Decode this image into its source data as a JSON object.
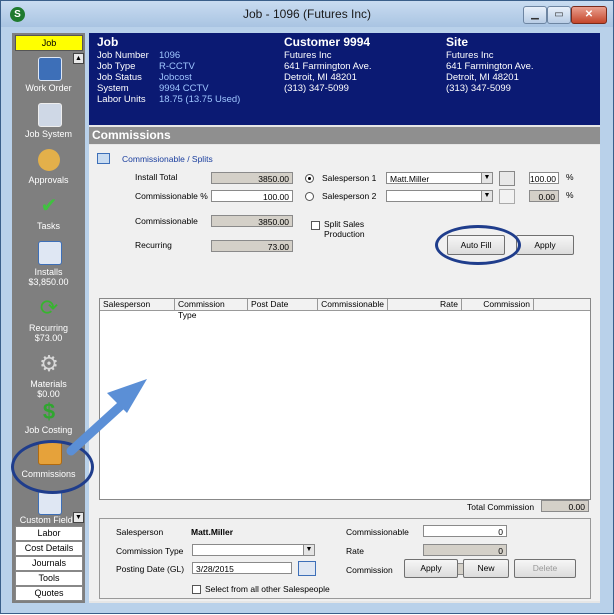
{
  "window": {
    "title": "Job - 1096 (Futures  Inc)",
    "app_icon": "S"
  },
  "sidebar": {
    "header": "Job",
    "items": [
      {
        "label": "Work Order",
        "sub": "",
        "icon": "work-order-icon"
      },
      {
        "label": "Job System",
        "sub": "",
        "icon": "job-system-icon"
      },
      {
        "label": "Approvals",
        "sub": "",
        "icon": "approvals-icon"
      },
      {
        "label": "Tasks",
        "sub": "",
        "icon": "tasks-icon"
      },
      {
        "label": "Installs",
        "sub": "$3,850.00",
        "icon": "installs-icon"
      },
      {
        "label": "Recurring",
        "sub": "$73.00",
        "icon": "recurring-icon"
      },
      {
        "label": "Materials",
        "sub": "$0.00",
        "icon": "materials-icon"
      },
      {
        "label": "Job Costing",
        "sub": "",
        "icon": "dollar-icon"
      },
      {
        "label": "Commissions",
        "sub": "",
        "icon": "commissions-icon"
      },
      {
        "label": "Custom Fields",
        "sub": "",
        "icon": "custom-fields-icon"
      }
    ],
    "links": [
      "Labor",
      "Cost Details",
      "Journals",
      "Tools",
      "Quotes"
    ]
  },
  "job": {
    "heading": "Job",
    "rows": [
      {
        "k": "Job Number",
        "v": "1096"
      },
      {
        "k": "Job Type",
        "v": "R-CCTV"
      },
      {
        "k": "Job Status",
        "v": "Jobcost"
      },
      {
        "k": "System",
        "v": "9994 CCTV"
      },
      {
        "k": "Labor Units",
        "v": "18.75 (13.75 Used)"
      }
    ]
  },
  "customer": {
    "heading": "Customer 9994",
    "lines": [
      "Futures  Inc",
      "641 Farmington Ave.",
      "Detroit, MI  48201",
      "(313) 347-5099"
    ]
  },
  "site": {
    "heading": "Site",
    "lines": [
      "Futures  Inc",
      "641 Farmington Ave.",
      "Detroit, MI  48201",
      "(313) 347-5099"
    ]
  },
  "commissions": {
    "title": "Commissions",
    "subtitle": "Commissionable / Splits",
    "install_total_label": "Install Total",
    "install_total": "3850.00",
    "commissionable_pct_label": "Commissionable %",
    "commissionable_pct": "100.00",
    "commissionable_label": "Commissionable",
    "commissionable": "3850.00",
    "recurring_label": "Recurring",
    "recurring": "73.00",
    "salesperson1_label": "Salesperson 1",
    "salesperson1": "Matt.Miller",
    "salesperson1_pct": "100.00",
    "salesperson2_label": "Salesperson 2",
    "salesperson2": "",
    "salesperson2_pct": "0.00",
    "pct_sign": "%",
    "split_label_1": "Split Sales",
    "split_label_2": "Production",
    "auto_fill": "Auto Fill",
    "apply": "Apply"
  },
  "grid": {
    "columns": [
      "Salesperson",
      "Commission Type",
      "Post Date",
      "Commissionable",
      "Rate",
      "Commission"
    ],
    "rows": []
  },
  "totals": {
    "label": "Total Commission",
    "value": "0.00"
  },
  "detail": {
    "salesperson_label": "Salesperson",
    "salesperson": "Matt.Miller",
    "commission_type_label": "Commission Type",
    "commission_type": "",
    "posting_date_label": "Posting Date (GL)",
    "posting_date": "3/28/2015",
    "commissionable_label": "Commissionable",
    "commissionable": "0",
    "rate_label": "Rate",
    "rate": "0",
    "commission_label": "Commission",
    "commission": "0",
    "select_all_label": "Select from all other Salespeople",
    "apply": "Apply",
    "new": "New",
    "delete": "Delete"
  },
  "colors": {
    "info_bar": "#0b1a73",
    "sidebar": "#7f7f7f",
    "active_tab": "#ffff00",
    "annotation": "#1f3d8c",
    "arrow": "#5b8fd6"
  }
}
